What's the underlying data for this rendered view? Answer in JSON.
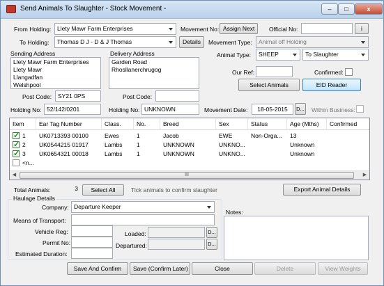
{
  "window": {
    "title": "Send Animals To Slaughter - Stock Movement -",
    "minimize": "–",
    "maximize": "□",
    "close": "x"
  },
  "header": {
    "from_holding_label": "From Holding:",
    "from_holding_value": "Llety Mawr Farm Enterprises",
    "to_holding_label": "To Holding:",
    "to_holding_value": "Thomas D J - D & J Thomas",
    "details_button": "Details",
    "movement_no_label": "Movement No:",
    "assign_next_button": "Assign Next",
    "official_no_label": "Official No:",
    "official_no_value": "",
    "info_button": "i",
    "movement_type_label": "Movement Type:",
    "movement_type_value": "Animal off Holding",
    "animal_type_label": "Animal Type:",
    "animal_type_value": "SHEEP",
    "destination_value": "To Slaughter",
    "our_ref_label": "Our Ref:",
    "our_ref_value": "",
    "confirmed_label": "Confirmed:",
    "select_animals_button": "Select Animals",
    "eid_reader_button": "EID Reader"
  },
  "sending": {
    "label": "Sending Address",
    "address": "Llety Mawr Farm Enterprises\nLlety Mawr\nLlangadfan\nWelshpool",
    "postcode_label": "Post Code:",
    "postcode_value": "SY21 0PS",
    "holding_no_label": "Holding No:",
    "holding_no_value": "52/142/0201"
  },
  "delivery": {
    "label": "Delivery Address",
    "address": "Garden Road\nRhosllanerchrugog",
    "postcode_label": "Post Code:",
    "postcode_value": "",
    "holding_no_label": "Holding No:",
    "holding_no_value": "UNKNOWN",
    "movement_date_label": "Movement Date:",
    "movement_date_value": "18-05-2015",
    "date_button": "D...",
    "within_business_label": "Within Business:"
  },
  "grid": {
    "columns": [
      "Item",
      "Ear Tag Number",
      "Class.",
      "No.",
      "Breed",
      "Sex",
      "Status",
      "Age (Mths)",
      "Confirmed"
    ],
    "rows": [
      {
        "item": "1",
        "tag": "UK0713393 00100",
        "class": "Ewes",
        "no": "1",
        "breed": "Jacob",
        "sex": "EWE",
        "status": "Non-Orga...",
        "age": "13",
        "confirmed": ""
      },
      {
        "item": "2",
        "tag": "UK0544215 01917",
        "class": "Lambs",
        "no": "1",
        "breed": "UNKNOWN",
        "sex": "UNKNO...",
        "status": "",
        "age": "Unknown",
        "confirmed": ""
      },
      {
        "item": "3",
        "tag": "UK0654321 00018",
        "class": "Lambs",
        "no": "1",
        "breed": "UNKNOWN",
        "sex": "UNKNO...",
        "status": "",
        "age": "Unknown",
        "confirmed": ""
      }
    ],
    "new_row": "<n...",
    "scroll_thumb": "III",
    "scroll_left": "◀",
    "scroll_right": "▶"
  },
  "totals": {
    "total_animals_label": "Total Animals:",
    "total_animals_value": "3",
    "select_all_button": "Select All",
    "hint": "Tick animals to confirm slaughter",
    "export_button": "Export Animal Details"
  },
  "haulage": {
    "label": "Haulage Details",
    "company_label": "Company:",
    "company_value": "Departure Keeper",
    "means_label": "Means of Transport:",
    "means_value": "",
    "vehicle_label": "Vehicle Reg:",
    "vehicle_value": "",
    "permit_label": "Permit No:",
    "permit_value": "",
    "duration_label": "Estimated Duration:",
    "duration_value": "",
    "loaded_label": "Loaded:",
    "loaded_value": "",
    "departured_label": "Departured:",
    "departured_value": "",
    "date_button": "D...",
    "notes_label": "Notes:",
    "notes_value": ""
  },
  "footer": {
    "save_confirm": "Save And Confirm",
    "save_confirm_later": "Save (Confirm Later)",
    "close": "Close",
    "delete": "Delete",
    "view_weights": "View Weights"
  }
}
